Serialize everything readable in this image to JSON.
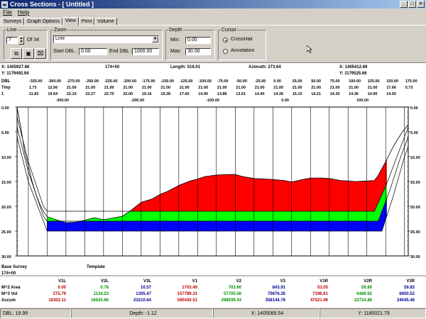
{
  "window": {
    "title": "Cross Sections - [ Untitled ]",
    "buttons": [
      "_",
      "□",
      "×"
    ]
  },
  "menu": {
    "file": "File",
    "help": "Help"
  },
  "tabs": [
    "Surveys",
    "Graph Options",
    "View",
    "Print",
    "Volume"
  ],
  "active_tab": "View",
  "line_group": {
    "label": "Line",
    "value": "7",
    "of_label": "Of 34"
  },
  "zoom_group": {
    "label": "Zoom",
    "select_value": "Line",
    "start_label": "Start DBL :",
    "start_value": "0.00",
    "end_label": "End DBL :",
    "end_value": "1000.00"
  },
  "depth_group": {
    "label": "Depth",
    "min_label": "Min:",
    "min_value": "0.00",
    "max_label": "Max:",
    "max_value": "30.00"
  },
  "cursor_group": {
    "label": "Cursor",
    "options": [
      "CrossHair",
      "Annotation"
    ],
    "selected": "CrossHair"
  },
  "header": {
    "left_x": "X: 1405927.66",
    "left_y": "Y: 1179492.94",
    "station": "174+00",
    "length": "Length: 516.01",
    "azimuth": "Azimuth: 273.64",
    "right_x": "X: 1405412.69",
    "right_y": "Y: 1179525.66",
    "row_labels": [
      "DBL",
      "Tmp",
      "1"
    ],
    "dbl": [
      "-325.00",
      "-300.00",
      "-275.00",
      "-250.00",
      "-225.00",
      "-200.00",
      "-175.00",
      "-150.00",
      "-125.00",
      "-100.00",
      "-75.00",
      "-50.00",
      "-25.00",
      "0.00",
      "25.00",
      "50.00",
      "75.00",
      "100.00",
      "125.00",
      "150.00",
      "175.00"
    ],
    "tmp": [
      "1.73",
      "12.56",
      "21.00",
      "21.00",
      "21.00",
      "21.00",
      "21.00",
      "21.00",
      "21.00",
      "21.00",
      "21.00",
      "21.00",
      "21.00",
      "21.00",
      "21.00",
      "21.00",
      "21.00",
      "21.00",
      "21.00",
      "17.66",
      "5.73"
    ],
    "srv": [
      "11.83",
      "19.54",
      "22.10",
      "23.27",
      "22.70",
      "22.00",
      "19.16",
      "19.28",
      "17.60",
      "14.90",
      "13.86",
      "13.51",
      "14.40",
      "14.36",
      "15.10",
      "14.21",
      "14.30",
      "14.36",
      "14.90",
      "14.50",
      ""
    ],
    "offsets": [
      "-300.00",
      "-200.00",
      "-100.00",
      "0.00",
      "100.00"
    ]
  },
  "chart_data": {
    "type": "area",
    "x_label": "DBL",
    "y_label": "Depth",
    "xlim": [
      -340,
      180
    ],
    "ylim": [
      30,
      0
    ],
    "y_ticks": [
      "0.00",
      "5.00",
      "10.00",
      "15.00",
      "20.00",
      "25.00",
      "30.00"
    ],
    "y_tick_values": [
      0,
      5,
      10,
      15,
      20,
      25,
      30
    ],
    "x_grid": [
      -325,
      -300,
      -275,
      -250,
      -225,
      -200,
      -175,
      -150,
      -125,
      -100,
      -75,
      -50,
      -25,
      0,
      25,
      50,
      75,
      100,
      125,
      150,
      175
    ],
    "survey": [
      [
        -340,
        0
      ],
      [
        -334,
        5
      ],
      [
        -330,
        9
      ],
      [
        -325,
        11.8
      ],
      [
        -320,
        15
      ],
      [
        -315,
        17.5
      ],
      [
        -310,
        19.5
      ],
      [
        -305,
        21
      ],
      [
        -300,
        22.1
      ],
      [
        -290,
        22.6
      ],
      [
        -275,
        23.3
      ],
      [
        -262,
        23.2
      ],
      [
        -250,
        22.8
      ],
      [
        -237,
        22.3
      ],
      [
        -225,
        22.7
      ],
      [
        -210,
        22.3
      ],
      [
        -200,
        22
      ],
      [
        -190,
        21
      ],
      [
        -175,
        19.2
      ],
      [
        -160,
        18.5
      ],
      [
        -150,
        17.6
      ],
      [
        -140,
        17
      ],
      [
        -125,
        15.8
      ],
      [
        -110,
        14.9
      ],
      [
        -100,
        14.5
      ],
      [
        -90,
        14
      ],
      [
        -75,
        13.7
      ],
      [
        -60,
        13.6
      ],
      [
        -50,
        13.6
      ],
      [
        -40,
        14
      ],
      [
        -25,
        14.4
      ],
      [
        -10,
        14.5
      ],
      [
        0,
        14.6
      ],
      [
        15,
        14.8
      ],
      [
        25,
        15.1
      ],
      [
        40,
        14.6
      ],
      [
        50,
        14.3
      ],
      [
        65,
        14.3
      ],
      [
        75,
        14.4
      ],
      [
        90,
        14.8
      ],
      [
        100,
        14.9
      ],
      [
        110,
        15
      ],
      [
        125,
        14.9
      ],
      [
        135,
        14.8
      ],
      [
        140,
        13.8
      ],
      [
        150,
        11
      ],
      [
        160,
        8
      ],
      [
        170,
        5.5
      ],
      [
        180,
        3.5
      ]
    ],
    "template_top": [
      [
        -340,
        2
      ],
      [
        -325,
        11
      ],
      [
        -305,
        20
      ],
      [
        -300,
        21
      ],
      [
        -200,
        21
      ],
      [
        -100,
        21
      ],
      [
        0,
        21
      ],
      [
        100,
        21
      ],
      [
        135,
        21
      ],
      [
        150,
        16
      ],
      [
        165,
        10
      ],
      [
        180,
        4
      ]
    ],
    "template_mid": [
      [
        -340,
        4
      ],
      [
        -325,
        13
      ],
      [
        -305,
        22
      ],
      [
        -300,
        23
      ],
      [
        -200,
        23
      ],
      [
        -100,
        23
      ],
      [
        0,
        23
      ],
      [
        100,
        23
      ],
      [
        140,
        23
      ],
      [
        155,
        17
      ],
      [
        170,
        10
      ],
      [
        180,
        6
      ]
    ],
    "template_bot": [
      [
        -340,
        6
      ],
      [
        -325,
        15
      ],
      [
        -300,
        25
      ],
      [
        -200,
        25
      ],
      [
        -100,
        25
      ],
      [
        0,
        25
      ],
      [
        100,
        25
      ],
      [
        145,
        25
      ],
      [
        160,
        18
      ],
      [
        175,
        10
      ],
      [
        180,
        8
      ]
    ],
    "colors": {
      "cut": "#ff0000",
      "layer1": "#00ff00",
      "layer2": "#0000ff",
      "survey_line": "#000000",
      "grid": "#000000"
    },
    "series": [
      {
        "name": "Base Survey",
        "color": "#000000"
      },
      {
        "name": "Template",
        "color": "#000000"
      }
    ]
  },
  "bottom_labels": {
    "base": "Base Survey",
    "template": "Template",
    "station": "174+00"
  },
  "summary": {
    "columns": [
      "V1L",
      "V2L",
      "V3L",
      "V1",
      "V2",
      "V3",
      "V1R",
      "V2R",
      "V3R"
    ],
    "rows": [
      {
        "label": "M^2 Area",
        "values": [
          "0.00",
          "0.78",
          "10.57",
          "1703.49",
          "703.60",
          "843.91",
          "53.05",
          "59.80",
          "59.83"
        ]
      },
      {
        "label": "M^3 Vol",
        "values": [
          "275.79",
          "1134.23",
          "1305.47",
          "157789.31",
          "57705.56",
          "70676.35",
          "7196.61",
          "6468.92",
          "6650.52"
        ]
      },
      {
        "label": "Accum",
        "values": [
          "18302.11",
          "16625.66",
          "23210.64",
          "590430.51",
          "298939.43",
          "358144.76",
          "47521.96",
          "23724.80",
          "24045.46"
        ]
      }
    ],
    "col_colors": [
      "#c00000",
      "#009000",
      "#000090",
      "#c00000",
      "#009000",
      "#000090",
      "#c00000",
      "#009000",
      "#000090"
    ]
  },
  "status": {
    "dbl": "DBL: 19.99",
    "depth": "Depth: -1.12",
    "x": "X: 1405089.54",
    "y": "Y: 1180021.79"
  }
}
